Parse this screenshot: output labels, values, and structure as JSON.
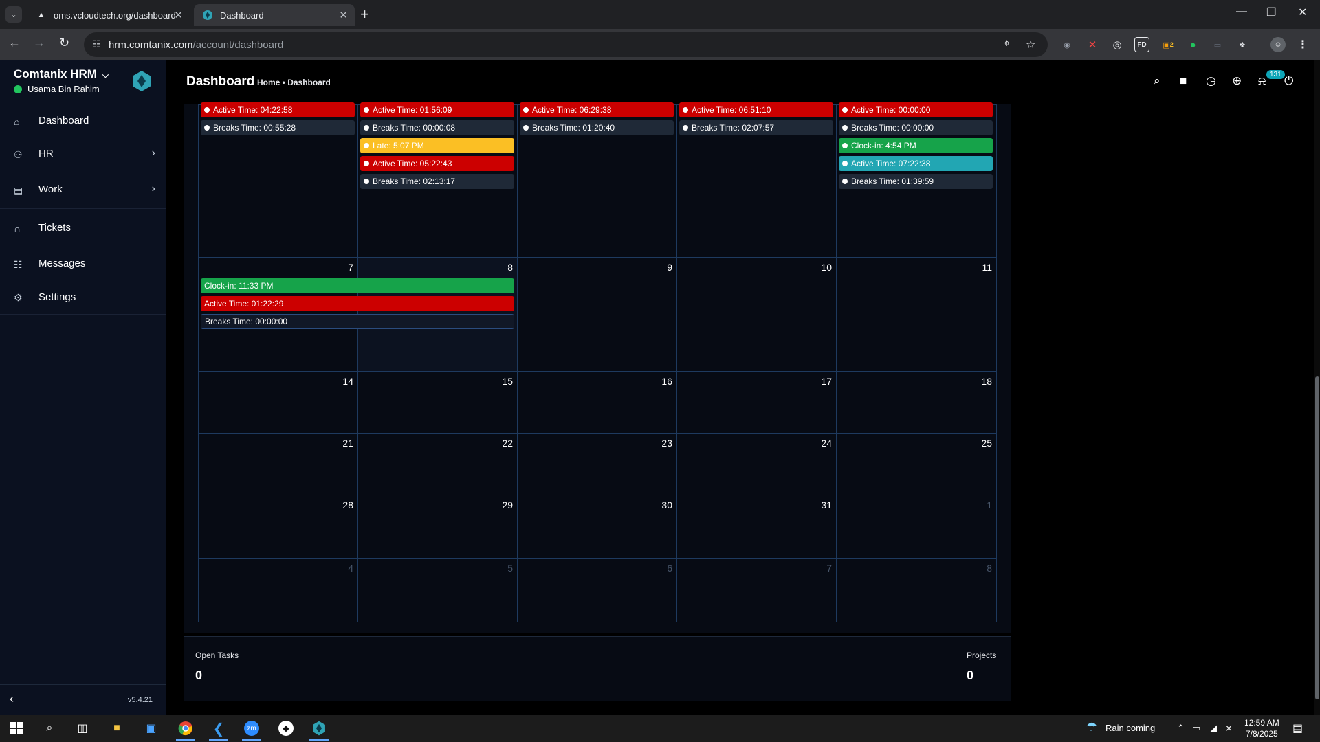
{
  "browser": {
    "tabs": [
      {
        "title": "oms.vcloudtech.org/dashboard",
        "favicon": "triangle-icon"
      },
      {
        "title": "Dashboard",
        "favicon": "comtanix-icon",
        "active": true
      }
    ],
    "url_host": "hrm.comtanix.com",
    "url_path": "/account/dashboard",
    "ext_fd_label": "FD",
    "ext_badge": "2"
  },
  "sidebar": {
    "brand": "Comtanix HRM",
    "user": "Usama Bin Rahim",
    "items": [
      {
        "label": "Dashboard",
        "icon": "home-icon"
      },
      {
        "label": "HR",
        "icon": "users-icon",
        "has_children": true
      },
      {
        "label": "Work",
        "icon": "briefcase-icon",
        "has_children": true
      },
      {
        "label": "Tickets",
        "icon": "headset-icon"
      },
      {
        "label": "Messages",
        "icon": "message-icon"
      },
      {
        "label": "Settings",
        "icon": "gear-icon"
      }
    ],
    "version": "v5.4.21"
  },
  "header": {
    "title": "Dashboard",
    "breadcrumb": "Home • Dashboard",
    "notification_count": "131"
  },
  "calendar": {
    "week1_events": [
      [
        {
          "text": "Active Time: 04:22:58",
          "color": "red"
        },
        {
          "text": "Breaks Time: 00:55:28",
          "color": "gray"
        }
      ],
      [
        {
          "text": "Active Time: 01:56:09",
          "color": "red"
        },
        {
          "text": "Breaks Time: 00:00:08",
          "color": "gray"
        },
        {
          "text": "Late: 5:07 PM",
          "color": "yellow"
        },
        {
          "text": "Active Time: 05:22:43",
          "color": "red"
        },
        {
          "text": "Breaks Time: 02:13:17",
          "color": "gray"
        }
      ],
      [
        {
          "text": "Active Time: 06:29:38",
          "color": "red"
        },
        {
          "text": "Breaks Time: 01:20:40",
          "color": "gray"
        }
      ],
      [
        {
          "text": "Active Time: 06:51:10",
          "color": "red"
        },
        {
          "text": "Breaks Time: 02:07:57",
          "color": "gray"
        }
      ],
      [
        {
          "text": "Active Time: 00:00:00",
          "color": "red"
        },
        {
          "text": "Breaks Time: 00:00:00",
          "color": "gray"
        },
        {
          "text": "Clock-in: 4:54 PM",
          "color": "green"
        },
        {
          "text": "Active Time: 07:22:38",
          "color": "teal"
        },
        {
          "text": "Breaks Time: 01:39:59",
          "color": "gray"
        }
      ]
    ],
    "weeks": [
      [
        "7",
        "8",
        "9",
        "10",
        "11"
      ],
      [
        "14",
        "15",
        "16",
        "17",
        "18"
      ],
      [
        "21",
        "22",
        "23",
        "24",
        "25"
      ],
      [
        "28",
        "29",
        "30",
        "31",
        "1"
      ],
      [
        "4",
        "5",
        "6",
        "7",
        "8"
      ]
    ],
    "other_month": [
      [
        false,
        false,
        false,
        false,
        false
      ],
      [
        false,
        false,
        false,
        false,
        false
      ],
      [
        false,
        false,
        false,
        false,
        false
      ],
      [
        false,
        false,
        false,
        false,
        true
      ],
      [
        true,
        true,
        true,
        true,
        true
      ]
    ],
    "span_events": [
      {
        "text": "Clock-in: 11:33 PM",
        "color": "green"
      },
      {
        "text": "Active Time: 01:22:29",
        "color": "red"
      },
      {
        "text": "Breaks Time: 00:00:00",
        "color": "navy"
      }
    ]
  },
  "stats": {
    "open_tasks_label": "Open Tasks",
    "open_tasks_value": "0",
    "projects_label": "Projects",
    "projects_value": "0"
  },
  "taskbar": {
    "weather": "Rain coming",
    "time": "12:59 AM",
    "date": "7/8/2025",
    "apps": [
      "windows-icon",
      "search-icon",
      "task-view-icon",
      "file-explorer-icon",
      "store-icon",
      "chrome-icon",
      "vscode-icon",
      "zoom-icon",
      "app-icon",
      "comtanix-icon"
    ],
    "zoom_label": "zm"
  }
}
